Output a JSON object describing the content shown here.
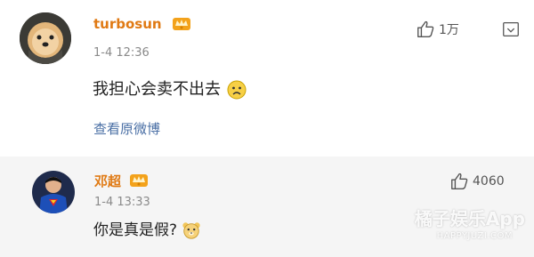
{
  "comments": [
    {
      "username": "turbosun",
      "time": "1-4 12:36",
      "content": "我担心会卖不出去",
      "link": "查看原微博",
      "likes": "1万",
      "avatar_icon": "dog-avatar",
      "badge_icon": "crown-icon",
      "emoji_icon": "sad-face-emoji"
    },
    {
      "username": "邓超",
      "time": "1-4 13:33",
      "content": "你是真是假?",
      "likes": "4060",
      "avatar_icon": "superman-avatar",
      "badge_icon": "crown-icon",
      "emoji_icon": "bear-face-emoji"
    }
  ],
  "watermark": {
    "main": "橘子娱乐App",
    "sub": "HAPPYJUZI.COM"
  },
  "colors": {
    "username": "#e07a14",
    "link": "#4a6fa5",
    "second_bg": "#f5f5f5"
  }
}
